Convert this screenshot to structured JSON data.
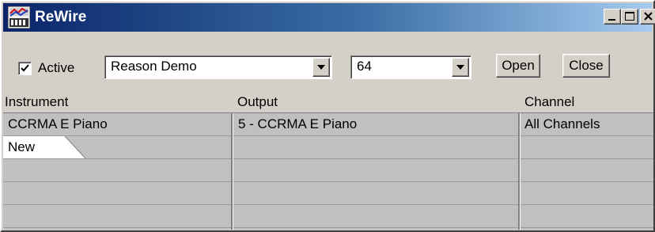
{
  "window": {
    "title": "ReWire",
    "colors": {
      "titlebar_start": "#0a246a",
      "titlebar_end": "#a6caf0",
      "face": "#d4d0c8",
      "grid": "#c0c0c0"
    }
  },
  "controls": {
    "active_label": "Active",
    "active_checked": true,
    "device_select": "Reason Demo",
    "channel_count_select": "64",
    "open_label": "Open",
    "close_label": "Close"
  },
  "table": {
    "columns": [
      "Instrument",
      "Output",
      "Channel"
    ],
    "rows": [
      {
        "instrument": "CCRMA E Piano",
        "output": "5 - CCRMA E Piano",
        "channel": "All Channels"
      },
      {
        "instrument": "New",
        "output": "",
        "channel": ""
      },
      {
        "instrument": "",
        "output": "",
        "channel": ""
      },
      {
        "instrument": "",
        "output": "",
        "channel": ""
      },
      {
        "instrument": "",
        "output": "",
        "channel": ""
      }
    ]
  },
  "icons": [
    "rewire-app-icon",
    "minimize-icon",
    "maximize-icon",
    "close-icon",
    "check-icon",
    "dropdown-arrow-icon"
  ]
}
